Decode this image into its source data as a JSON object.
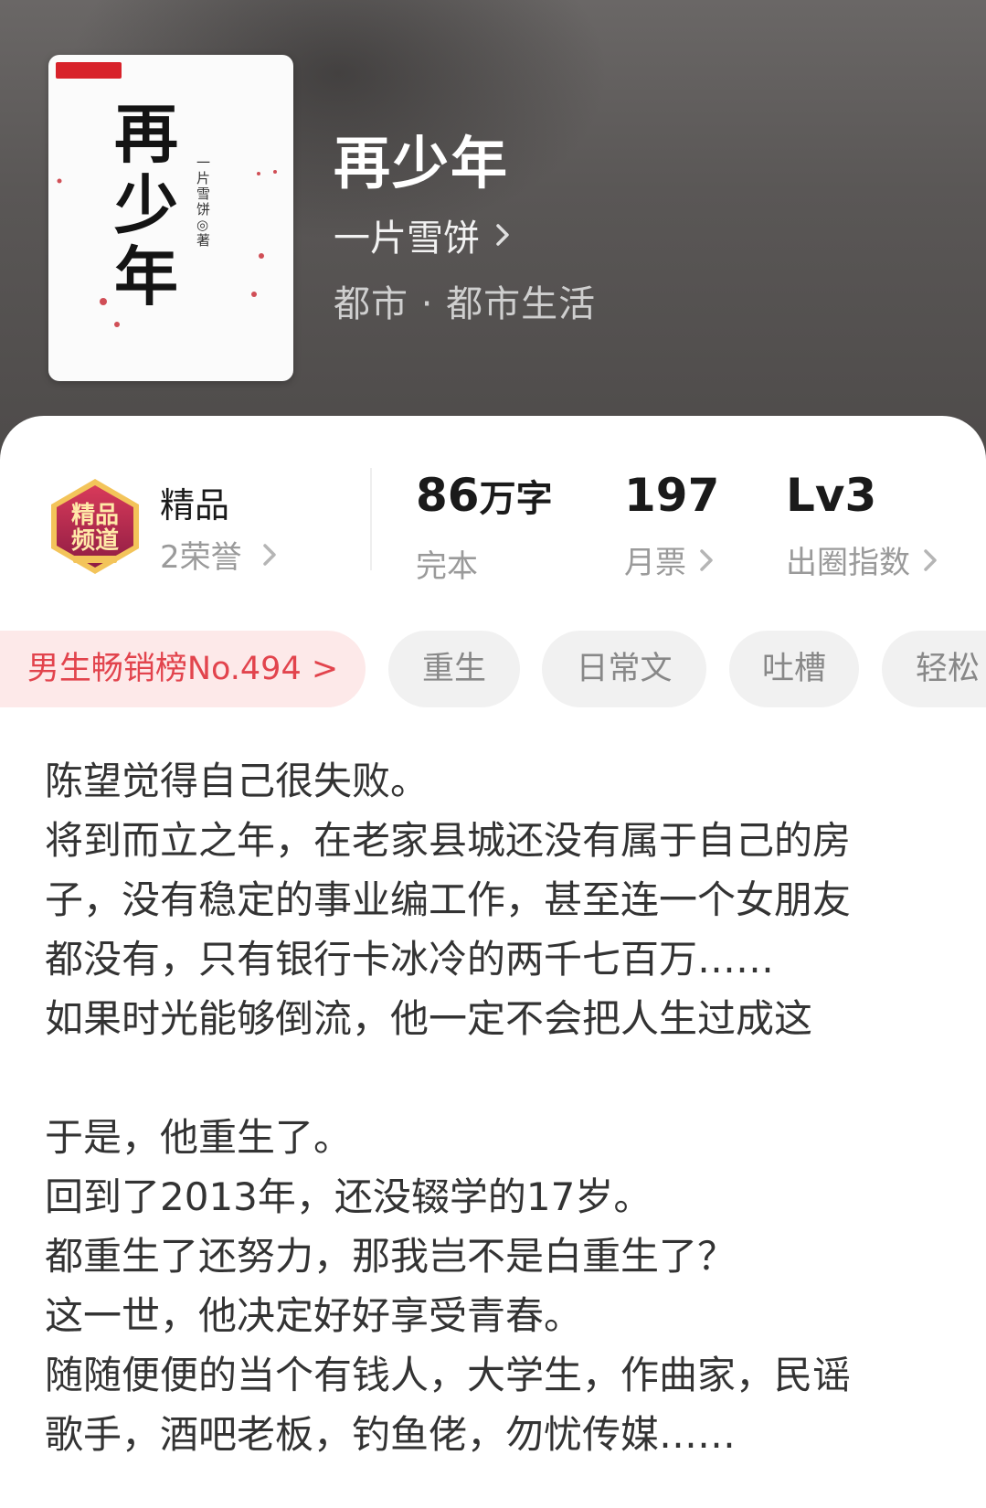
{
  "book": {
    "title": "再少年",
    "author": "一片雪饼",
    "genre": "都市 · 都市生活",
    "cover": {
      "title_art": "再少年",
      "author_line": "一片雪饼◎著"
    }
  },
  "honor": {
    "emblem_text": "精品频道",
    "title": "精品",
    "subtitle": "2荣誉"
  },
  "stats": {
    "words": {
      "number": "86",
      "unit": "万字",
      "label": "完本"
    },
    "tickets": {
      "value": "197",
      "label": "月票"
    },
    "level": {
      "value": "Lv3",
      "label": "出圈指数"
    }
  },
  "tags": {
    "rank": "男生畅销榜No.494 >",
    "items": [
      "重生",
      "日常文",
      "吐槽",
      "轻松"
    ]
  },
  "blurb": {
    "lines": [
      "陈望觉得自己很失败。",
      "将到而立之年，在老家县城还没有属于自己的房",
      "子，没有稳定的事业编工作，甚至连一个女朋友",
      "都没有，只有银行卡冰冷的两千七百万……",
      "如果时光能够倒流，他一定不会把人生过成这",
      "",
      "于是，他重生了。",
      "回到了2013年，还没辍学的17岁。",
      "都重生了还努力，那我岂不是白重生了？",
      "这一世，他决定好好享受青春。",
      "随随便便的当个有钱人，大学生，作曲家，民谣",
      "歌手，酒吧老板，钓鱼佬，勿忧传媒……"
    ]
  },
  "colors": {
    "rank_tag_bg": "#fde9e9",
    "rank_tag_text": "#e2444d",
    "tag_bg": "#f1f1f1"
  }
}
